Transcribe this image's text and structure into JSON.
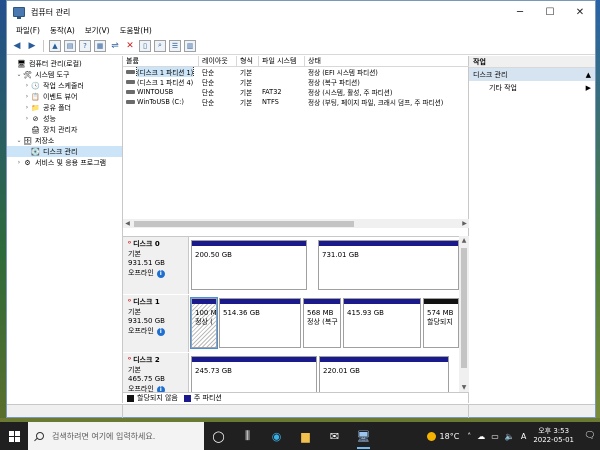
{
  "window": {
    "title": "컴퓨터 관리",
    "min": "─",
    "max": "☐",
    "close": "✕"
  },
  "menu": [
    "파일(F)",
    "동작(A)",
    "보기(V)",
    "도움말(H)"
  ],
  "tree": [
    {
      "label": "컴퓨터 관리(로컬)",
      "depth": 0,
      "twisty": ""
    },
    {
      "label": "시스템 도구",
      "depth": 1,
      "twisty": "⌄"
    },
    {
      "label": "작업 스케줄러",
      "depth": 2,
      "twisty": "›"
    },
    {
      "label": "이벤트 뷰어",
      "depth": 2,
      "twisty": "›"
    },
    {
      "label": "공유 폴더",
      "depth": 2,
      "twisty": "›"
    },
    {
      "label": "성능",
      "depth": 2,
      "twisty": "›"
    },
    {
      "label": "장치 관리자",
      "depth": 2,
      "twisty": ""
    },
    {
      "label": "저장소",
      "depth": 1,
      "twisty": "⌄"
    },
    {
      "label": "디스크 관리",
      "depth": 2,
      "twisty": "",
      "selected": true
    },
    {
      "label": "서비스 및 응용 프로그램",
      "depth": 1,
      "twisty": "›"
    }
  ],
  "volume_columns": [
    "볼륨",
    "레이아웃",
    "형식",
    "파일 시스템",
    "상태"
  ],
  "volumes": [
    {
      "name": "(디스크 1 파티션 1)",
      "layout": "단순",
      "type": "기본",
      "fs": "",
      "status": "정상 (EFI 시스템 파티션)",
      "selected": true
    },
    {
      "name": "(디스크 1 파티션 4)",
      "layout": "단순",
      "type": "기본",
      "fs": "",
      "status": "정상 (복구 파티션)"
    },
    {
      "name": "WINTOUSB",
      "layout": "단순",
      "type": "기본",
      "fs": "FAT32",
      "status": "정상 (시스템, 활성, 주 파티션)"
    },
    {
      "name": "WinToUSB (C:)",
      "layout": "단순",
      "type": "기본",
      "fs": "NTFS",
      "status": "정상 (부팅, 페이지 파일, 크래시 덤프, 주 파티션)"
    }
  ],
  "disks": [
    {
      "name": "디스크 0",
      "kind": "기본",
      "size": "931.51 GB",
      "state": "오프라인",
      "parts": [
        {
          "text": "200.50 GB",
          "status": "",
          "style": "blue"
        },
        {
          "text": "731.01 GB",
          "status": "",
          "style": "blue"
        }
      ]
    },
    {
      "name": "디스크 1",
      "kind": "기본",
      "size": "931.50 GB",
      "state": "오프라인",
      "parts": [
        {
          "text": "100 M",
          "status": "정상 (",
          "style": "hatch"
        },
        {
          "text": "514.36 GB",
          "status": "",
          "style": "blue"
        },
        {
          "text": "568 MB",
          "status": "정상 (복구",
          "style": "blue"
        },
        {
          "text": "415.93 GB",
          "status": "",
          "style": "blue"
        },
        {
          "text": "574 MB",
          "status": "할당되지",
          "style": "dark"
        }
      ]
    },
    {
      "name": "디스크 2",
      "kind": "기본",
      "size": "465.75 GB",
      "state": "오프라인",
      "parts": [
        {
          "text": "245.73 GB",
          "status": "",
          "style": "blue"
        },
        {
          "text": "220.01 GB",
          "status": "",
          "style": "blue"
        }
      ]
    }
  ],
  "legend": {
    "unallocated": "할당되지 않음",
    "primary": "주 파티션"
  },
  "actions": {
    "title": "작업",
    "section": "디스크 관리",
    "item": "기타 작업"
  },
  "taskbar": {
    "search_placeholder": "검색하려면 여기에 입력하세요.",
    "weather": "18°C",
    "ime": "A",
    "time": "오후 3:53",
    "date": "2022-05-01"
  }
}
